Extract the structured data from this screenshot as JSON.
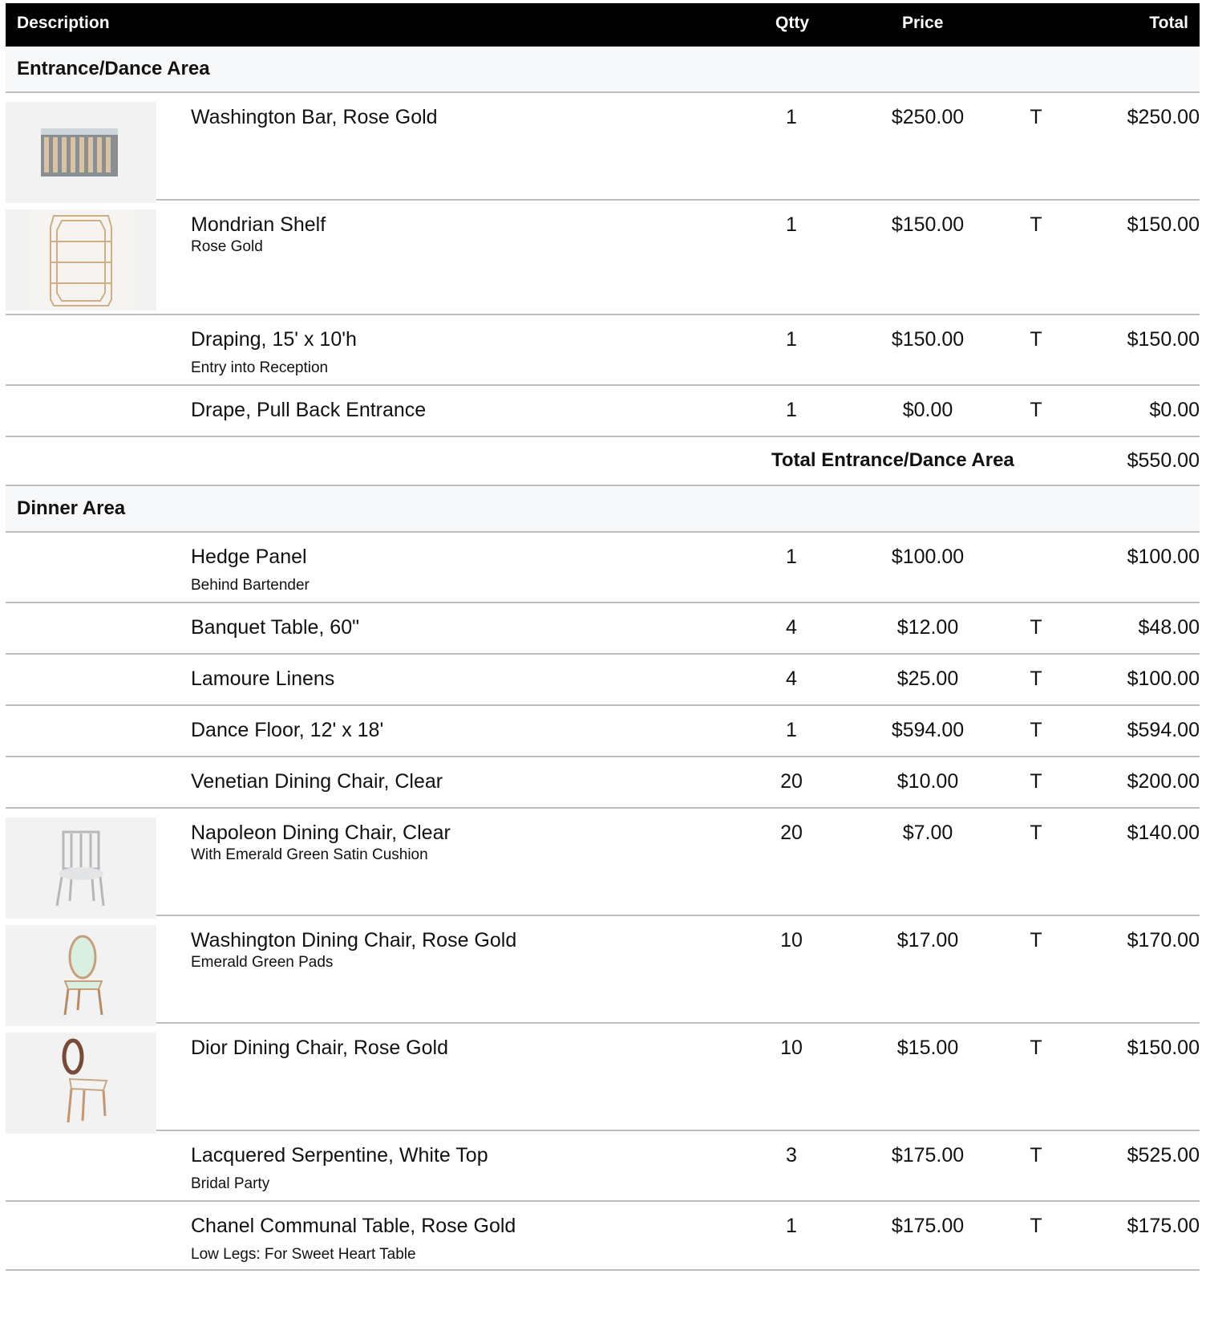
{
  "header": {
    "description": "Description",
    "qty": "Qtty",
    "price": "Price",
    "total": "Total"
  },
  "sections": [
    {
      "title": "Entrance/Dance Area",
      "items": [
        {
          "name": "Washington Bar, Rose Gold",
          "sub": "",
          "qty": "1",
          "price": "$250.00",
          "tax": "T",
          "total": "$250.00",
          "image": "bar-icon"
        },
        {
          "name": "Mondrian Shelf",
          "sub": "Rose Gold",
          "qty": "1",
          "price": "$150.00",
          "tax": "T",
          "total": "$150.00",
          "image": "shelf-icon"
        },
        {
          "name": "Draping, 15' x 10'h",
          "sub": "Entry into Reception",
          "qty": "1",
          "price": "$150.00",
          "tax": "T",
          "total": "$150.00",
          "image": ""
        },
        {
          "name": "Drape, Pull Back Entrance",
          "sub": "",
          "qty": "1",
          "price": "$0.00",
          "tax": "T",
          "total": "$0.00",
          "image": ""
        }
      ],
      "subtotal_label": "Total Entrance/Dance Area",
      "subtotal_value": "$550.00"
    },
    {
      "title": "Dinner Area",
      "items": [
        {
          "name": "Hedge Panel",
          "sub": "Behind Bartender",
          "qty": "1",
          "price": "$100.00",
          "tax": "",
          "total": "$100.00",
          "image": ""
        },
        {
          "name": "Banquet Table, 60\"",
          "sub": "",
          "qty": "4",
          "price": "$12.00",
          "tax": "T",
          "total": "$48.00",
          "image": ""
        },
        {
          "name": "Lamoure Linens",
          "sub": "",
          "qty": "4",
          "price": "$25.00",
          "tax": "T",
          "total": "$100.00",
          "image": ""
        },
        {
          "name": "Dance Floor, 12' x 18'",
          "sub": "",
          "qty": "1",
          "price": "$594.00",
          "tax": "T",
          "total": "$594.00",
          "image": ""
        },
        {
          "name": "Venetian Dining Chair, Clear",
          "sub": "",
          "qty": "20",
          "price": "$10.00",
          "tax": "T",
          "total": "$200.00",
          "image": ""
        },
        {
          "name": "Napoleon Dining Chair, Clear",
          "sub": "With Emerald Green Satin Cushion",
          "qty": "20",
          "price": "$7.00",
          "tax": "T",
          "total": "$140.00",
          "image": "clear-chair-icon"
        },
        {
          "name": "Washington Dining Chair, Rose Gold",
          "sub": "Emerald Green Pads",
          "qty": "10",
          "price": "$17.00",
          "tax": "T",
          "total": "$170.00",
          "image": "green-chair-icon"
        },
        {
          "name": "Dior Dining Chair, Rose Gold",
          "sub": "",
          "qty": "10",
          "price": "$15.00",
          "tax": "T",
          "total": "$150.00",
          "image": "dior-chair-icon"
        },
        {
          "name": "Lacquered Serpentine, White Top",
          "sub": "Bridal Party",
          "qty": "3",
          "price": "$175.00",
          "tax": "T",
          "total": "$525.00",
          "image": ""
        },
        {
          "name": "Chanel Communal Table, Rose Gold",
          "sub": "Low Legs: For Sweet Heart Table",
          "qty": "1",
          "price": "$175.00",
          "tax": "T",
          "total": "$175.00",
          "image": ""
        }
      ]
    }
  ]
}
